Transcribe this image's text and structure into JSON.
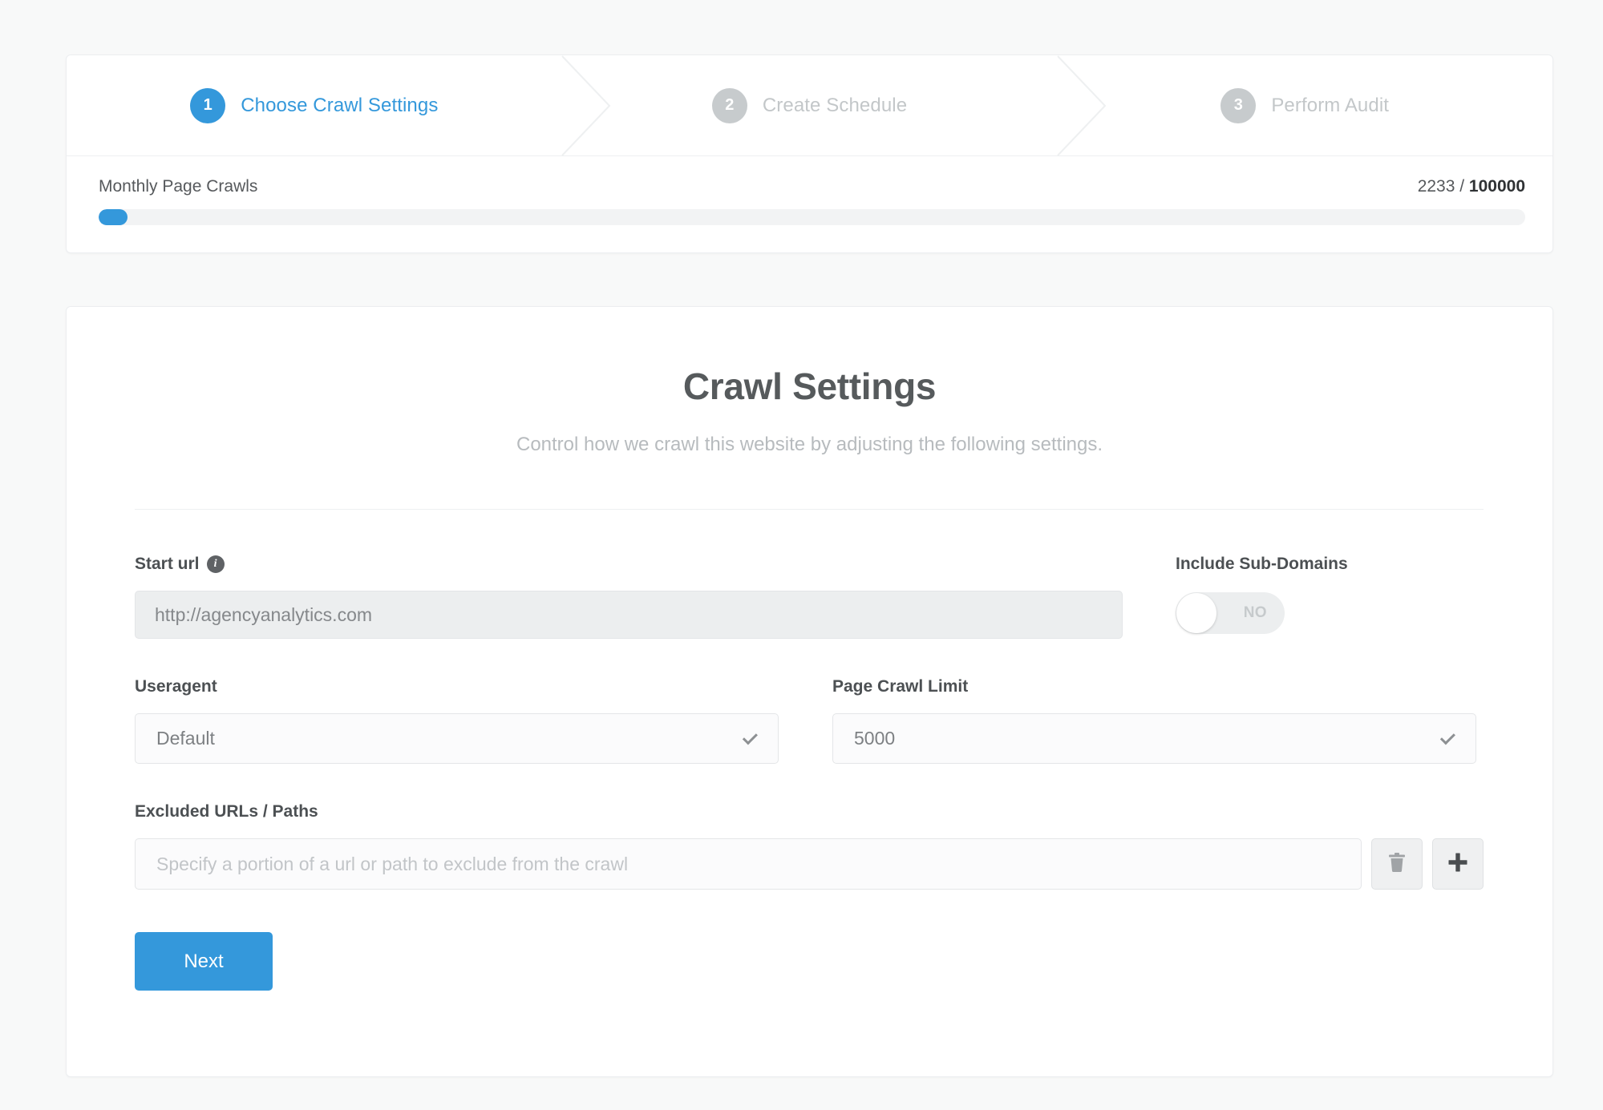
{
  "stepper": {
    "steps": [
      {
        "number": "1",
        "label": "Choose Crawl Settings",
        "state": "active"
      },
      {
        "number": "2",
        "label": "Create Schedule",
        "state": "inactive"
      },
      {
        "number": "3",
        "label": "Perform Audit",
        "state": "inactive"
      }
    ]
  },
  "quota": {
    "title": "Monthly Page Crawls",
    "used": "2233",
    "separator": " / ",
    "total": "100000",
    "percent": 2.233
  },
  "settings": {
    "title": "Crawl Settings",
    "subtitle": "Control how we crawl this website by adjusting the following settings.",
    "start_url": {
      "label": "Start url",
      "info_glyph": "i",
      "value": "http://agencyanalytics.com"
    },
    "include_subdomains": {
      "label": "Include Sub-Domains",
      "state_label": "NO",
      "checked": false
    },
    "useragent": {
      "label": "Useragent",
      "value": "Default"
    },
    "page_crawl_limit": {
      "label": "Page Crawl Limit",
      "value": "5000"
    },
    "excluded_urls": {
      "label": "Excluded URLs / Paths",
      "placeholder": "Specify a portion of a url or path to exclude from the crawl",
      "value": ""
    },
    "next_label": "Next"
  },
  "colors": {
    "accent": "#3498db",
    "inactive_step": "#c7cbcd",
    "page_bg": "#f8f9f9",
    "card_bg": "#ffffff",
    "title_text": "#565a5c",
    "muted_text": "#b7bbbe"
  }
}
